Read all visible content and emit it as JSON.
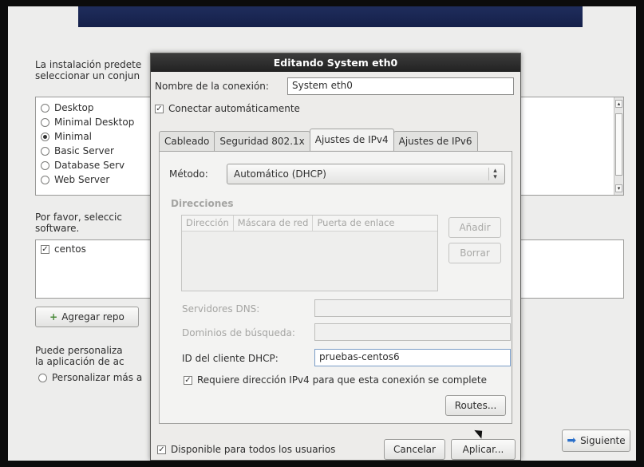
{
  "background": {
    "intro_line1": "La instalación predete",
    "intro_line2": "seleccionar un conjun",
    "install_options": [
      {
        "label": "Desktop",
        "selected": false
      },
      {
        "label": "Minimal Desktop",
        "selected": false
      },
      {
        "label": "Minimal",
        "selected": true
      },
      {
        "label": "Basic Server",
        "selected": false
      },
      {
        "label": "Database Serv",
        "selected": false
      },
      {
        "label": "Web Server",
        "selected": false
      }
    ],
    "repo_prompt_line1": "Por favor, seleccic",
    "repo_prompt_line2": "software.",
    "repo_items": [
      {
        "label": "centos",
        "checked": true
      }
    ],
    "add_repo_button": "Agregar repo",
    "customize_line1": "Puede personaliza",
    "customize_line2": "la aplicación de ac",
    "customize_option": "Personalizar más a",
    "next_button": "Siguiente"
  },
  "dialog": {
    "title": "Editando System eth0",
    "connection_name_label": "Nombre de la conexión:",
    "connection_name_value": "System eth0",
    "auto_connect_label": "Conectar automáticamente",
    "auto_connect_checked": true,
    "tabs": [
      {
        "label": "Cableado",
        "active": false
      },
      {
        "label": "Seguridad 802.1x",
        "active": false
      },
      {
        "label": "Ajustes de IPv4",
        "active": true
      },
      {
        "label": "Ajustes de IPv6",
        "active": false
      }
    ],
    "method_label": "Método:",
    "method_value": "Automático (DHCP)",
    "addresses_heading": "Direcciones",
    "address_columns": [
      "Dirección",
      "Máscara de red",
      "Puerta de enlace"
    ],
    "add_button": "Añadir",
    "delete_button": "Borrar",
    "dns_label": "Servidores DNS:",
    "dns_value": "",
    "search_domains_label": "Dominios de búsqueda:",
    "search_domains_value": "",
    "dhcp_client_id_label": "ID del cliente DHCP:",
    "dhcp_client_id_value": "pruebas-centos6",
    "require_ipv4_label": "Requiere dirección IPv4 para que esta conexión se complete",
    "require_ipv4_checked": true,
    "routes_button": "Routes...",
    "available_all_users_label": "Disponible para todos los usuarios",
    "available_all_users_checked": true,
    "cancel_button": "Cancelar",
    "apply_button": "Aplicar..."
  },
  "colors": {
    "banner": "#1f2d5c",
    "titlebar": "#2a2a2a",
    "next_arrow": "#2a6fc9"
  }
}
